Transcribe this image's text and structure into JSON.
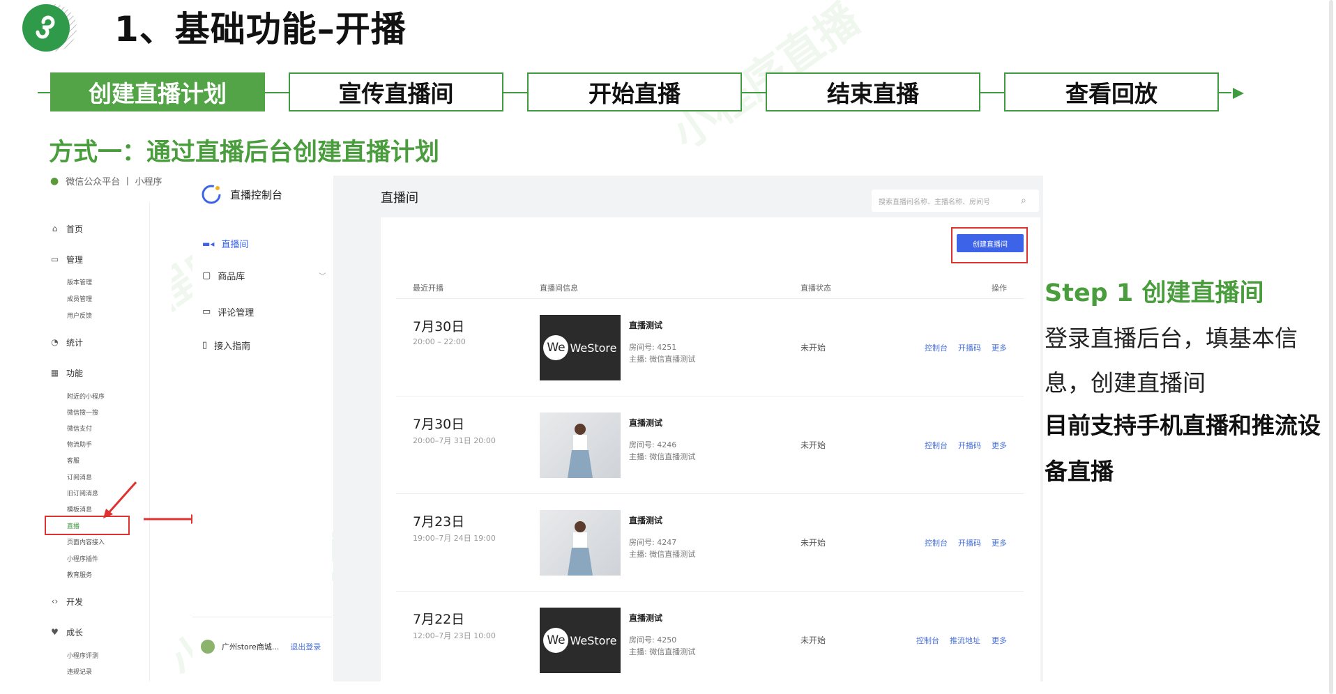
{
  "header": {
    "title": "1、基础功能–开播",
    "logo_icon": "mini-program-logo-icon"
  },
  "steps": [
    "创建直播计划",
    "宣传直播间",
    "开始直播",
    "结束直播",
    "查看回放"
  ],
  "active_step": 0,
  "method_title": "方式一：通过直播后台创建直播计划",
  "wx_sidebar": {
    "header": "微信公众平台 丨 小程序",
    "items": [
      {
        "label": "首页",
        "icon": "home-icon"
      },
      {
        "label": "管理",
        "icon": "folder-icon",
        "subs": [
          "版本管理",
          "成员管理",
          "用户反馈"
        ]
      },
      {
        "label": "统计",
        "icon": "pie-chart-icon"
      },
      {
        "label": "功能",
        "icon": "grid-icon",
        "subs": [
          "附近的小程序",
          "微信搜一搜",
          "微信支付",
          "物流助手",
          "客服",
          "订阅消息",
          "旧订阅消息",
          "模板消息",
          "直播",
          "页面内容接入",
          "小程序插件",
          "教育服务"
        ]
      },
      {
        "label": "开发",
        "icon": "code-icon"
      },
      {
        "label": "成长",
        "icon": "growth-icon",
        "subs": [
          "小程序评测",
          "违规记录"
        ]
      }
    ]
  },
  "console": {
    "title": "直播控制台",
    "nav": [
      {
        "label": "直播间",
        "icon": "video-icon",
        "active": true
      },
      {
        "label": "商品库",
        "icon": "bag-icon"
      },
      {
        "label": "评论管理",
        "icon": "comment-icon"
      },
      {
        "label": "接入指南",
        "icon": "book-icon"
      }
    ],
    "account": "广州store商城...",
    "logout": "退出登录"
  },
  "main": {
    "title": "直播间",
    "search_placeholder": "搜索直播间名称、主播名称、房间号",
    "create_button": "创建直播间",
    "columns": [
      "最近开播",
      "直播间信息",
      "直播状态",
      "操作"
    ],
    "rows": [
      {
        "date": "7月30日",
        "time": "20:00 – 22:00",
        "thumb": "store",
        "name": "直播测试",
        "room": "房间号:  4251",
        "host": "主播:    微信直播测试",
        "status": "未开始",
        "actions": [
          "控制台",
          "开播码",
          "更多"
        ]
      },
      {
        "date": "7月30日",
        "time": "20:00–7月 31日 20:00",
        "thumb": "photo",
        "name": "直播测试",
        "room": "房间号:  4246",
        "host": "主播:    微信直播测试",
        "status": "未开始",
        "actions": [
          "控制台",
          "开播码",
          "更多"
        ]
      },
      {
        "date": "7月23日",
        "time": "19:00–7月 24日 19:00",
        "thumb": "photo",
        "name": "直播测试",
        "room": "房间号:  4247",
        "host": "主播:    微信直播测试",
        "status": "未开始",
        "actions": [
          "控制台",
          "开播码",
          "更多"
        ]
      },
      {
        "date": "7月22日",
        "time": "12:00–7月 23日 10:00",
        "thumb": "store",
        "name": "直播测试",
        "room": "房间号:  4250",
        "host": "主播:    微信直播测试",
        "status": "未开始",
        "actions": [
          "控制台",
          "推流地址",
          "更多"
        ]
      }
    ],
    "store_brand": "WeStore"
  },
  "right": {
    "step_title": "Step 1 创建直播间",
    "desc": "登录直播后台，填基本信息，创建直播间",
    "note": "目前支持手机直播和推流设备直播"
  },
  "watermark": "小程序直播",
  "colors": {
    "green": "#4a9d3c",
    "step_fill": "#52a447",
    "red": "#e03131",
    "blue": "#3d63e8"
  }
}
